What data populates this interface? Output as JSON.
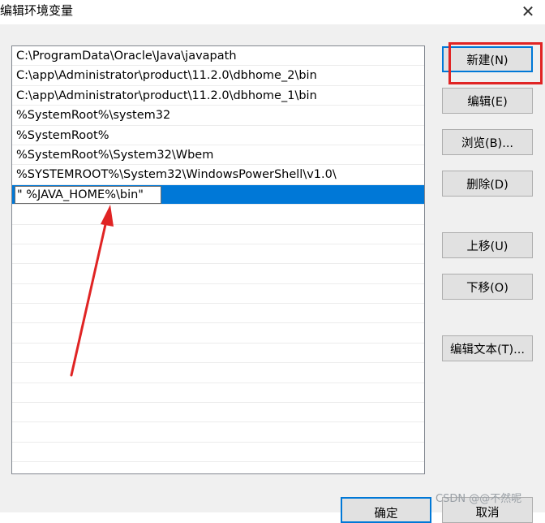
{
  "window": {
    "title": "编辑环境变量",
    "close_glyph": "✕"
  },
  "list": {
    "items": [
      "C:\\ProgramData\\Oracle\\Java\\javapath",
      "C:\\app\\Administrator\\product\\11.2.0\\dbhome_2\\bin",
      "C:\\app\\Administrator\\product\\11.2.0\\dbhome_1\\bin",
      "%SystemRoot%\\system32",
      "%SystemRoot%",
      "%SystemRoot%\\System32\\Wbem",
      "%SYSTEMROOT%\\System32\\WindowsPowerShell\\v1.0\\"
    ],
    "editing_value": "\" %JAVA_HOME%\\bin\"",
    "empty_rows": 13
  },
  "buttons": {
    "new": "新建(N)",
    "edit": "编辑(E)",
    "browse": "浏览(B)...",
    "delete": "删除(D)",
    "move_up": "上移(U)",
    "move_down": "下移(O)",
    "edit_text": "编辑文本(T)...",
    "ok": "确定",
    "cancel": "取消"
  },
  "annotation": {
    "highlight_color": "#e02424",
    "arrow_color": "#e02424"
  },
  "watermark": "CSDN @@不然呢",
  "colors": {
    "selection": "#0078d7",
    "button_bg": "#e1e1e1",
    "dialog_bg": "#f0f0f0"
  }
}
